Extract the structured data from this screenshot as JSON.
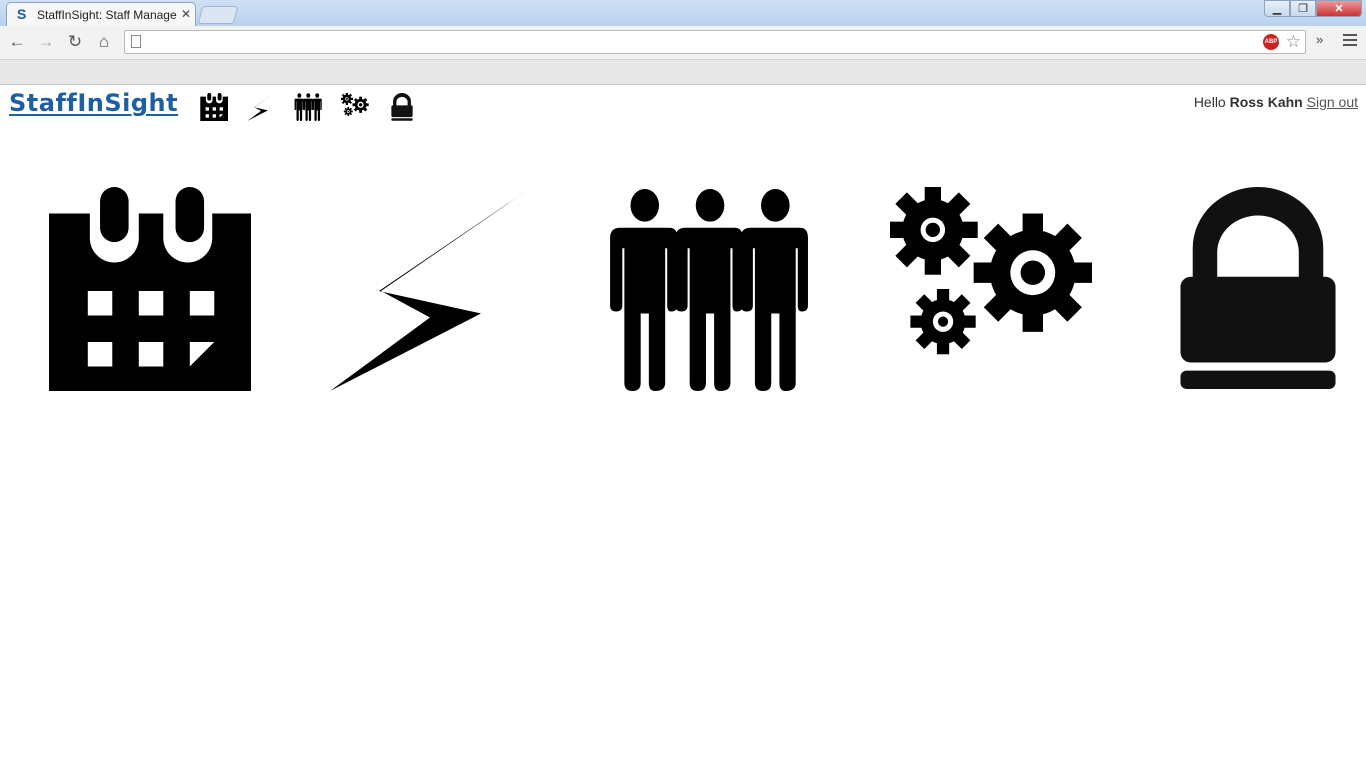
{
  "browser": {
    "tab_title": "StaffInSight: Staff Management",
    "tab_favicon": "S",
    "close_glyph": "✕",
    "address": "",
    "more_glyph": "»",
    "abp_text": "ABP"
  },
  "header": {
    "logo_text": "StaffInSight",
    "greeting": "Hello",
    "user_name": "Ross Kahn",
    "sign_out": "Sign out"
  },
  "nav_icons": [
    "calendar-icon",
    "lightning-icon",
    "people-icon",
    "gears-icon",
    "lock-icon"
  ],
  "colors": {
    "brand": "#1e5fa3",
    "icon": "#000000"
  }
}
